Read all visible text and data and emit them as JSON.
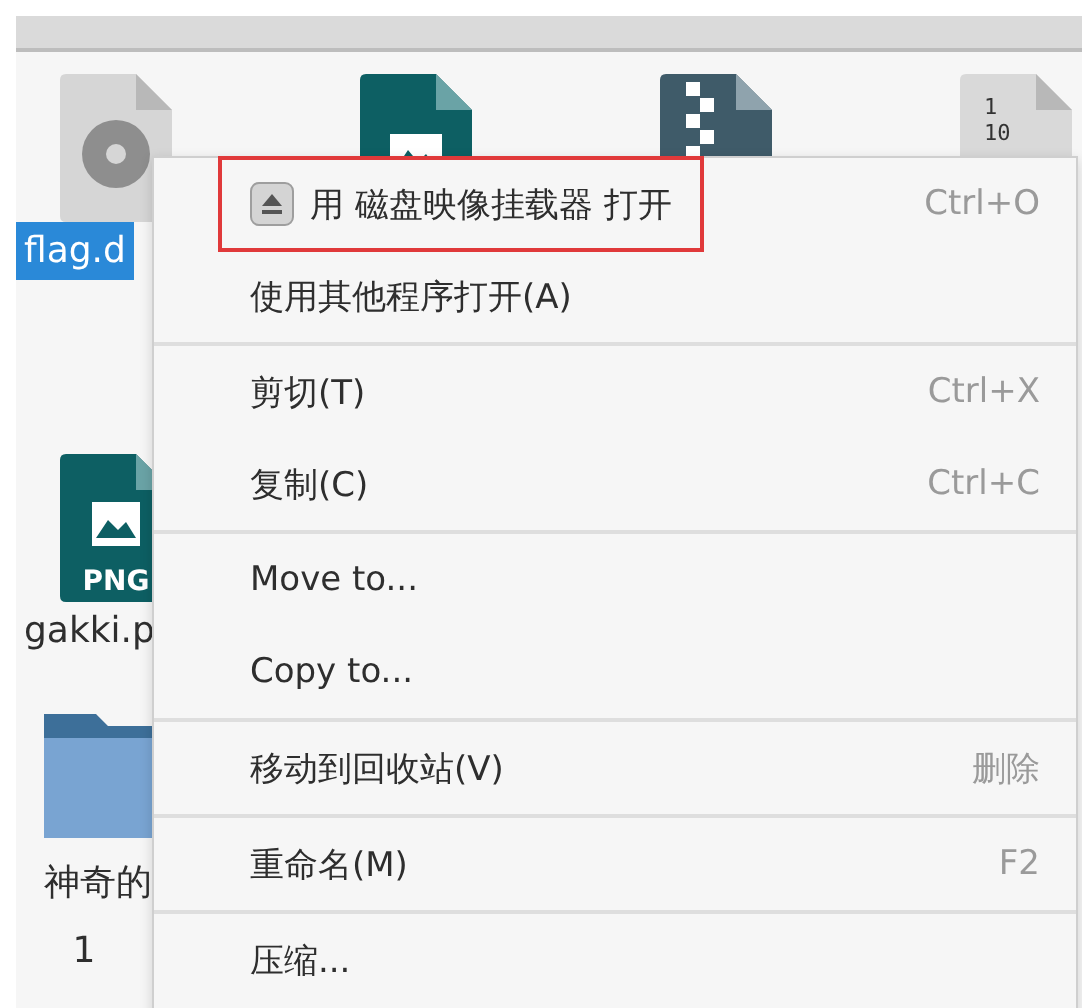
{
  "file_rows": [
    [
      {
        "kind": "disc",
        "label": "flag.d",
        "selected": true
      },
      {
        "kind": "image",
        "selected": false
      },
      {
        "kind": "archive",
        "selected": false
      },
      {
        "kind": "binary",
        "icon_text": [
          "1",
          "10"
        ],
        "selected": false
      }
    ],
    [
      {
        "kind": "png",
        "icon_text": [
          "PNG"
        ],
        "label": "gakki.p",
        "selected": false
      }
    ],
    [
      {
        "kind": "folder",
        "label_lines": [
          "神奇的",
          "1"
        ],
        "selected": false
      }
    ]
  ],
  "context_menu": {
    "sections": [
      [
        {
          "kind": "mount",
          "label": "用 磁盘映像挂载器 打开",
          "shortcut": "Ctrl+O",
          "outlined": true
        },
        {
          "kind": "plain",
          "label": "使用其他程序打开(A)",
          "outlined": false
        }
      ],
      [
        {
          "kind": "plain",
          "label": "剪切(T)",
          "shortcut": "Ctrl+X",
          "outlined": false
        },
        {
          "kind": "plain",
          "label": "复制(C)",
          "shortcut": "Ctrl+C",
          "outlined": false
        }
      ],
      [
        {
          "kind": "plain",
          "label": "Move to...",
          "outlined": false
        },
        {
          "kind": "plain",
          "label": "Copy to...",
          "outlined": false
        }
      ],
      [
        {
          "kind": "plain",
          "label": "移动到回收站(V)",
          "shortcut": "删除",
          "outlined": false
        }
      ],
      [
        {
          "kind": "plain",
          "label": "重命名(M)",
          "shortcut": "F2",
          "outlined": false
        }
      ],
      [
        {
          "kind": "plain",
          "label": "压缩...",
          "outlined": false
        }
      ]
    ]
  }
}
